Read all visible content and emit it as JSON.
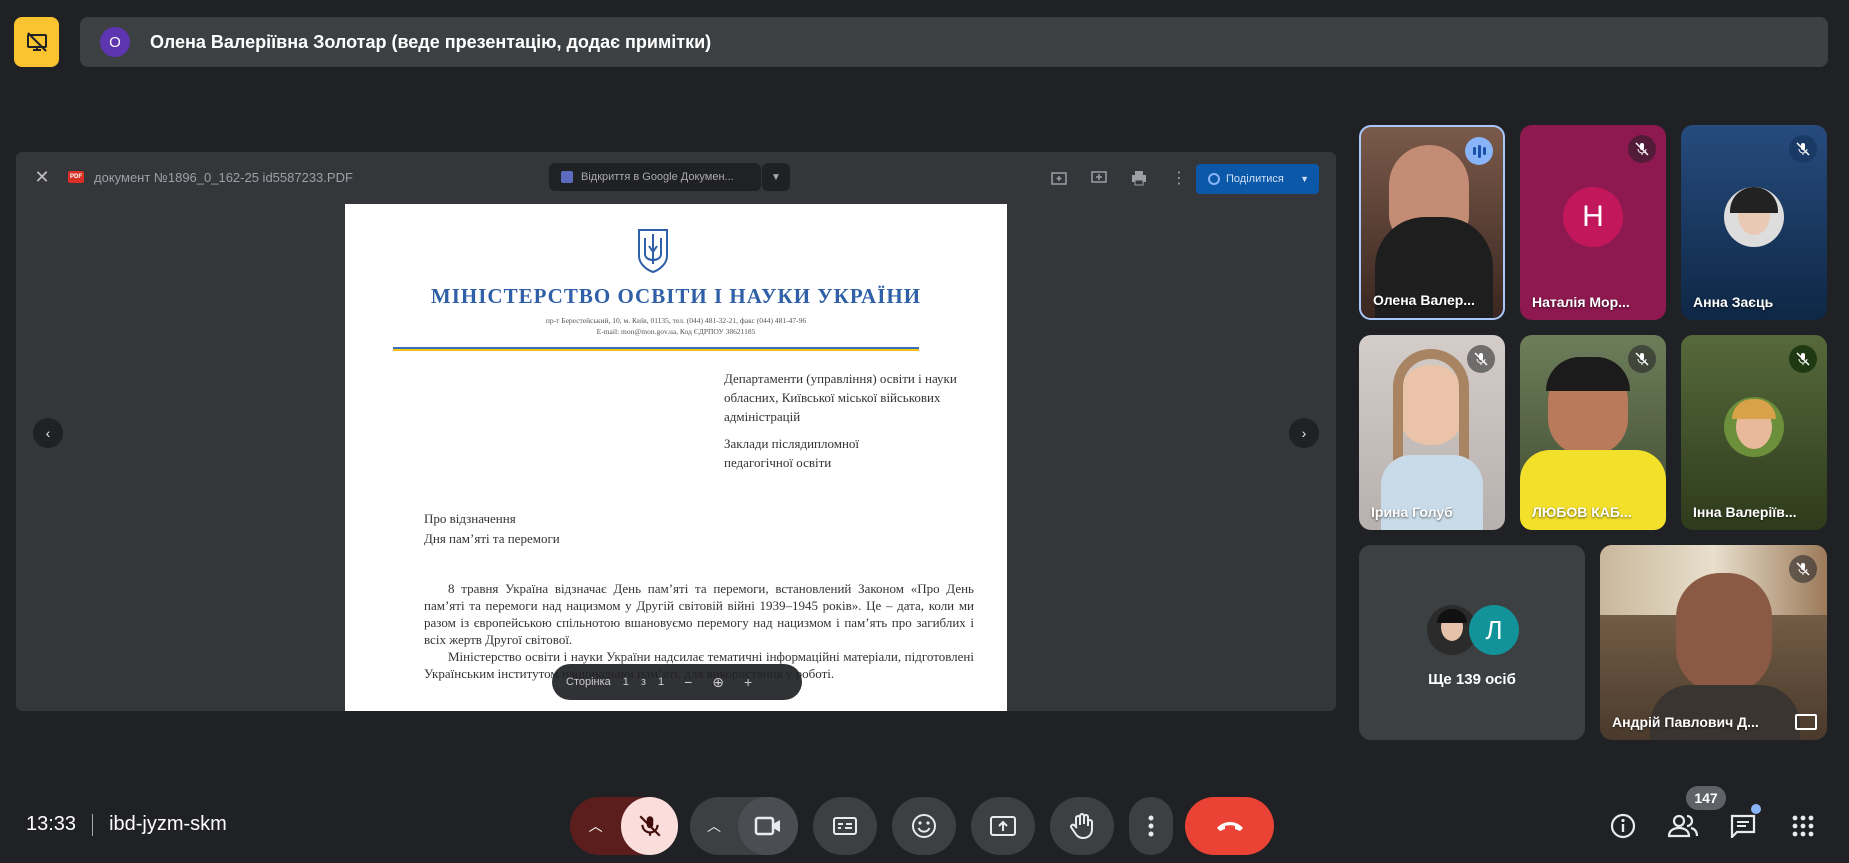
{
  "header": {
    "presenter_initial": "О",
    "presenter_text": "Олена Валеріївна Золотар (веде презентацію, додає примітки)"
  },
  "presentation": {
    "filename": "документ №1896_0_162-25 id5587233.PDF",
    "pdf_badge": "PDF",
    "open_with_label": "Відкриття в Google Докумен...",
    "share_label": "Поділитися",
    "page_control": {
      "label": "Сторінка",
      "current": "1",
      "of": "з",
      "total": "1"
    },
    "document": {
      "ministry": "МІНІСТЕРСТВО ОСВІТИ І НАУКИ УКРАЇНИ",
      "address_line1": "пр-т Берестейський, 10, м. Київ, 01135, тел. (044) 481-32-21, факс (044) 481-47-96",
      "address_line2": "E-mail: mon@mon.gov.ua, Код ЄДРПОУ 38621185",
      "addressee1": "Департаменти (управління) освіти і науки обласних, Київської міської військових адміністрацій",
      "addressee2": "Заклади післядипломної педагогічної освіти",
      "subject_line1": "Про відзначення",
      "subject_line2": "Дня пам’яті та перемоги",
      "body1": "8 травня Україна відзначає День пам’яті та перемоги, встановлений Законом «Про День пам’яті та перемоги над нацизмом у Другій світовій війні 1939–1945 років». Це – дата, коли ми разом із європейською спільнотою вшановуємо перемогу над нацизмом і пам’ять про загиблих і всіх жертв Другої світової.",
      "body2": "Міністерство освіти і науки України надсилає тематичні інформаційні матеріали, підготовлені Українським інститутом національної пам’яті, для використання у роботі."
    }
  },
  "participants": [
    {
      "name": "Олена Валер...",
      "state": "speaking"
    },
    {
      "name": "Наталія Мор...",
      "initial": "Н",
      "avatar_color": "#c2185b",
      "state": "muted"
    },
    {
      "name": "Анна Заєць",
      "state": "muted"
    },
    {
      "name": "Ірина Голуб",
      "state": "muted"
    },
    {
      "name": "ЛЮБОВ КАБ...",
      "state": "muted"
    },
    {
      "name": "Інна Валеріїв...",
      "state": "muted"
    },
    {
      "name": "Андрій Павлович Д...",
      "state": "muted"
    }
  ],
  "more_people": {
    "initial": "Л",
    "label": "Ще 139 осіб"
  },
  "bottom_bar": {
    "time": "13:33",
    "meeting_code": "ibd-jyzm-skm",
    "people_count": "147"
  },
  "colors": {
    "end_call": "#ea4335",
    "mic_muted_bg": "#f9dedc",
    "presentation_icon": "#f9c42f",
    "accent": "#8ab4f8"
  }
}
